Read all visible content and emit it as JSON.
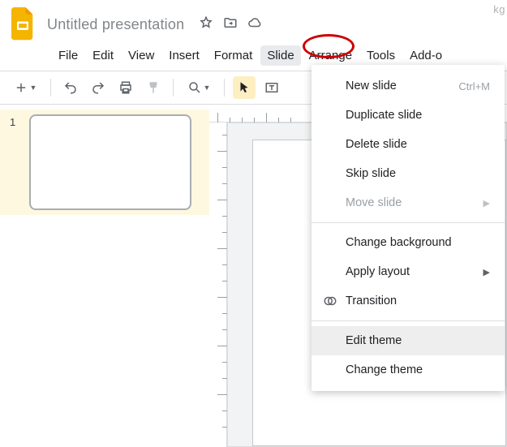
{
  "header": {
    "doc_title": "Untitled presentation"
  },
  "menubar": {
    "items": [
      "File",
      "Edit",
      "View",
      "Insert",
      "Format",
      "Slide",
      "Arrange",
      "Tools",
      "Add-o"
    ]
  },
  "toolbar": {
    "bg_text": "kg"
  },
  "sidepanel": {
    "thumbs": [
      {
        "num": "1"
      }
    ]
  },
  "dropdown": {
    "items": [
      {
        "label": "New slide",
        "shortcut": "Ctrl+M"
      },
      {
        "label": "Duplicate slide"
      },
      {
        "label": "Delete slide"
      },
      {
        "label": "Skip slide"
      },
      {
        "label": "Move slide",
        "disabled": true,
        "submenu": true
      },
      {
        "sep": true
      },
      {
        "label": "Change background"
      },
      {
        "label": "Apply layout",
        "submenu": true
      },
      {
        "label": "Transition",
        "icon": "transition"
      },
      {
        "sep": true
      },
      {
        "label": "Edit theme",
        "highlight": true
      },
      {
        "label": "Change theme"
      }
    ]
  }
}
